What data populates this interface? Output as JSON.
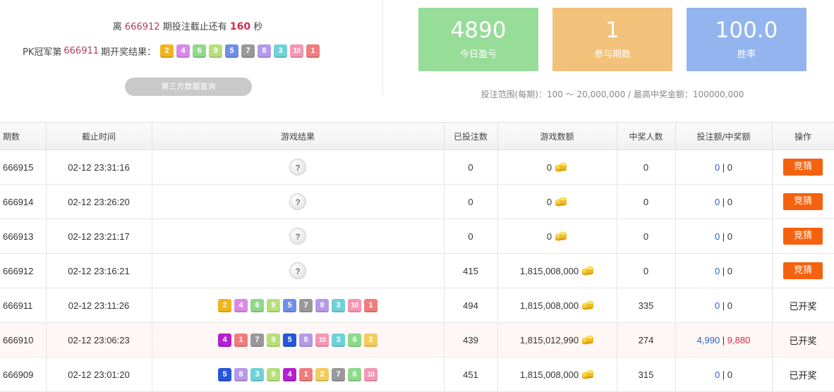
{
  "countdown": {
    "prefix": "离",
    "issue": "666912",
    "middle": "期投注截止还有",
    "seconds": "160",
    "suffix": "秒"
  },
  "last_result": {
    "prefix": "PK冠军第",
    "issue": "666911",
    "suffix": "期开奖结果：",
    "balls": [
      "2",
      "4",
      "6",
      "9",
      "5",
      "7",
      "8",
      "3",
      "10",
      "1"
    ]
  },
  "third_party_button": "第三方数据查询",
  "stats": [
    {
      "value": "4890",
      "label": "今日盈亏",
      "color": "#98dc9a"
    },
    {
      "value": "1",
      "label": "参与期数",
      "color": "#f2c27a"
    },
    {
      "value": "100.0",
      "label": "胜率",
      "color": "#93b4ef"
    }
  ],
  "bet_range": "投注范围(每期)：100 ～ 20,000,000 / 最高中奖金额：100000,000",
  "table": {
    "headers": [
      "期数",
      "截止时间",
      "游戏结果",
      "已投注数",
      "游戏数额",
      "中奖人数",
      "投注额/中奖额",
      "操作"
    ],
    "rows": [
      {
        "issue": "666915",
        "time": "02-12 23:31:16",
        "result": "?",
        "bets": "0",
        "amount": "0",
        "winners": "0",
        "bet_amt": "0",
        "win_amt": "0",
        "action": "竞猜"
      },
      {
        "issue": "666914",
        "time": "02-12 23:26:20",
        "result": "?",
        "bets": "0",
        "amount": "0",
        "winners": "0",
        "bet_amt": "0",
        "win_amt": "0",
        "action": "竞猜"
      },
      {
        "issue": "666913",
        "time": "02-12 23:21:17",
        "result": "?",
        "bets": "0",
        "amount": "0",
        "winners": "0",
        "bet_amt": "0",
        "win_amt": "0",
        "action": "竞猜"
      },
      {
        "issue": "666912",
        "time": "02-12 23:16:21",
        "result": "?",
        "bets": "415",
        "amount": "1,815,008,000",
        "winners": "0",
        "bet_amt": "0",
        "win_amt": "0",
        "action": "竞猜"
      },
      {
        "issue": "666911",
        "time": "02-12 23:11:26",
        "balls": [
          "2",
          "4",
          "6",
          "9",
          "5",
          "7",
          "8",
          "3",
          "10",
          "1"
        ],
        "bets": "494",
        "amount": "1,815,008,000",
        "winners": "335",
        "bet_amt": "0",
        "win_amt": "0",
        "action": "已开奖"
      },
      {
        "issue": "666910",
        "time": "02-12 23:06:23",
        "balls": [
          "4",
          "1",
          "7",
          "9",
          "5",
          "8",
          "10",
          "3",
          "6",
          "2"
        ],
        "bets": "439",
        "amount": "1,815,012,990",
        "winners": "274",
        "bet_amt": "4,990",
        "win_amt": "9,880",
        "action": "已开奖"
      },
      {
        "issue": "666909",
        "time": "02-12 23:01:20",
        "balls": [
          "5",
          "8",
          "3",
          "9",
          "4",
          "1",
          "2",
          "7",
          "6",
          "10"
        ],
        "bets": "451",
        "amount": "1,815,008,000",
        "winners": "315",
        "bet_amt": "0",
        "win_amt": "0",
        "action": "已开奖"
      }
    ]
  }
}
